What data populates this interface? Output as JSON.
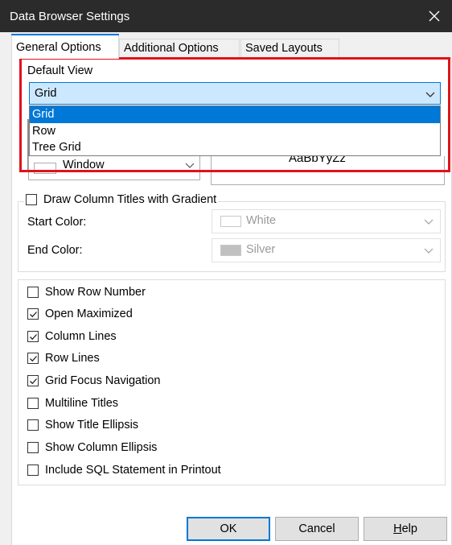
{
  "window": {
    "title": "Data Browser Settings"
  },
  "tabs": [
    {
      "label": "General Options"
    },
    {
      "label": "Additional Options"
    },
    {
      "label": "Saved Layouts"
    }
  ],
  "default_view": {
    "label": "Default View",
    "value": "Grid",
    "options": [
      "Grid",
      "Row",
      "Tree Grid"
    ]
  },
  "partially_hidden": {
    "window_color_text": "Window",
    "font_preview_text": "AaBbYyZz"
  },
  "gradient": {
    "checkbox_label": "Draw Column Titles with Gradient",
    "checked": false,
    "start_label": "Start Color:",
    "start_value": "White",
    "start_swatch": "#ffffff",
    "end_label": "End Color:",
    "end_value": "Silver",
    "end_swatch": "#c0c0c0"
  },
  "options": [
    {
      "label": "Show Row Number",
      "checked": false
    },
    {
      "label": "Open Maximized",
      "checked": true
    },
    {
      "label": "Column Lines",
      "checked": true
    },
    {
      "label": "Row Lines",
      "checked": true
    },
    {
      "label": "Grid Focus Navigation",
      "checked": true
    },
    {
      "label": "Multiline Titles",
      "checked": false
    },
    {
      "label": "Show Title Ellipsis",
      "checked": false
    },
    {
      "label": "Show Column Ellipsis",
      "checked": false
    },
    {
      "label": "Include SQL Statement in Printout",
      "checked": false
    }
  ],
  "buttons": {
    "ok": "OK",
    "cancel": "Cancel",
    "help_first": "H",
    "help_rest": "elp"
  },
  "colors": {
    "titlebar": "#2b2b2b",
    "accent": "#0078d7",
    "highlight": "#e0121b",
    "selected_combo": "#cce8ff"
  }
}
